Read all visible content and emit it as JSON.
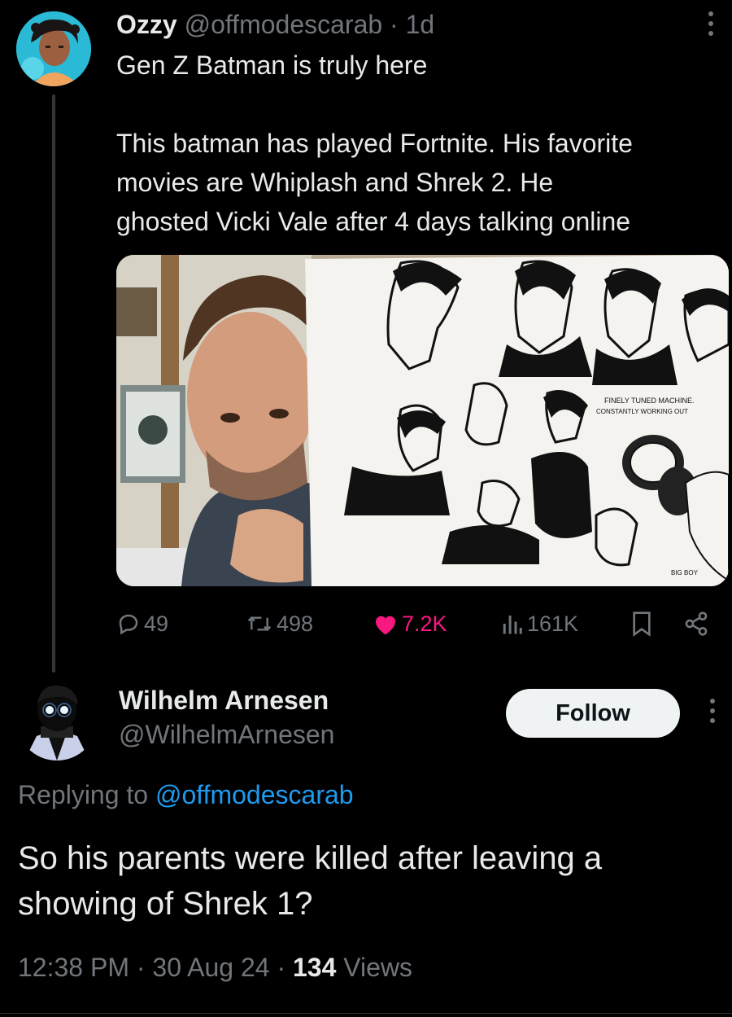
{
  "tweet": {
    "author_name": "Ozzy",
    "author_handle": "@offmodescarab",
    "separator": "·",
    "time": "1d",
    "text_line1": "Gen Z Batman is truly here",
    "text_line2": "This batman has played Fortnite.  His favorite",
    "text_line3": "movies are Whiplash and Shrek 2. He",
    "text_line4": "ghosted Vicki Vale after 4 days talking online",
    "media": {
      "caption_line1": "FINELY TUNED MACHINE.",
      "caption_line2": "CONSTANTLY WORKING OUT",
      "caption_line3": "BIG BOY"
    },
    "actions": {
      "replies": "49",
      "retweets": "498",
      "likes": "7.2K",
      "views": "161K"
    }
  },
  "reply": {
    "author_name": "Wilhelm Arnesen",
    "author_handle": "@WilhelmArnesen",
    "follow_label": "Follow",
    "replying_prefix": "Replying to",
    "replying_handle": "@offmodescarab",
    "text": "So his parents were killed after leaving a showing of Shrek 1?",
    "time": "12:38 PM",
    "sep1": "·",
    "date": "30 Aug 24",
    "sep2": "·",
    "views_count": "134",
    "views_label": "Views"
  },
  "colors": {
    "background": "#000000",
    "text": "#e7e9ea",
    "muted": "#71767b",
    "like": "#f91880",
    "link": "#1d9bf0"
  },
  "icons": [
    "reply-icon",
    "retweet-icon",
    "heart-icon",
    "views-icon",
    "bookmark-icon",
    "share-icon",
    "more-icon"
  ]
}
